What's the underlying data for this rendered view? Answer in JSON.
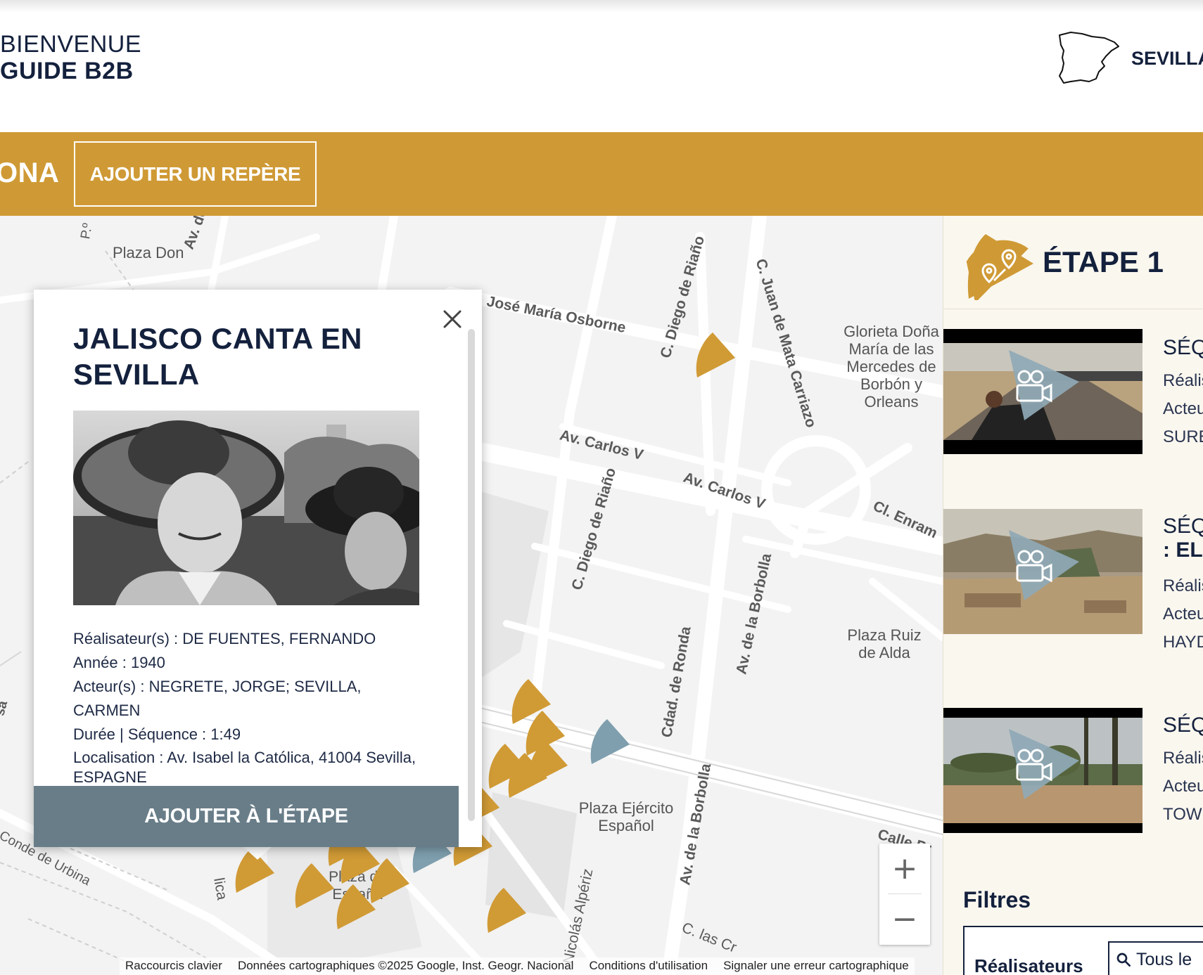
{
  "header": {
    "welcome_line1": "BIENVENUE",
    "welcome_line2": "GUIDE B2B",
    "city": "SEVILLA"
  },
  "goldbar": {
    "truncated_title": "ONA",
    "add_marker_label": "AJOUTER UN REPÈRE"
  },
  "map": {
    "places": [
      "Plaza Don",
      "Glorieta Doña María de las Mercedes de Borbón y Orleans",
      "Plaza Ruiz de Alda",
      "Plaza Ejército Español",
      "Plaza de España"
    ],
    "streets": [
      "Av. de",
      "P.º",
      "José María Osborne",
      "C. Diego de Riaño",
      "C. Juan de Mata Carriazo",
      "Av. Carlos V",
      "Av. Carlos V",
      "Cl. Enram",
      "C. Diego de Riaño",
      "Cdad. de Ronda",
      "Av. de la Borbolla",
      "Av. de la Borbolla",
      "Calle Pr",
      "Conde de Urbina",
      "C. las Cr",
      "Nicolás Alpériz",
      "lica",
      "sa"
    ],
    "zoom_in": "+",
    "zoom_out": "−",
    "attribution": [
      "Raccourcis clavier",
      "Données cartographiques ©2025 Google, Inst. Geogr. Nacional",
      "Conditions d'utilisation",
      "Signaler une erreur cartographique"
    ],
    "marker_color": "#d09a35",
    "selected_marker_color": "#7f9fae"
  },
  "popup": {
    "title_line1": "JALISCO CANTA EN",
    "title_line2": "SEVILLA",
    "directors": "Réalisateur(s) : DE FUENTES, FERNANDO",
    "year": "Année : 1940",
    "actors": "Acteur(s) : NEGRETE, JORGE; SEVILLA, CARMEN",
    "duration": "Durée | Séquence : 1:49",
    "location": "Localisation : Av. Isabel la Católica, 41004 Sevilla, ESPAGNE",
    "add_to_step": "AJOUTER À L'ÉTAPE"
  },
  "panel": {
    "step_title": "ÉTAPE 1",
    "sequences": [
      {
        "title": "SÉQ",
        "title2": "",
        "line1": "Réalis",
        "line2": "Acteu",
        "line3": "SURE"
      },
      {
        "title": "SÉQ",
        "title2": ": EL ",
        "line1": "Réalis",
        "line2": "Acteu",
        "line3": "HAYD"
      },
      {
        "title": "SÉQ",
        "title2": "",
        "line1": "Réalis",
        "line2": "Acteu",
        "line3": "TOW"
      }
    ],
    "filters_title": "Filtres",
    "filter_label": "Réalisateurs",
    "filter_search_placeholder": "Tous le"
  },
  "colors": {
    "gold": "#cf9a35",
    "navy": "#14213d",
    "slate_button": "#687d88",
    "panel_bg": "#faf7ef"
  }
}
